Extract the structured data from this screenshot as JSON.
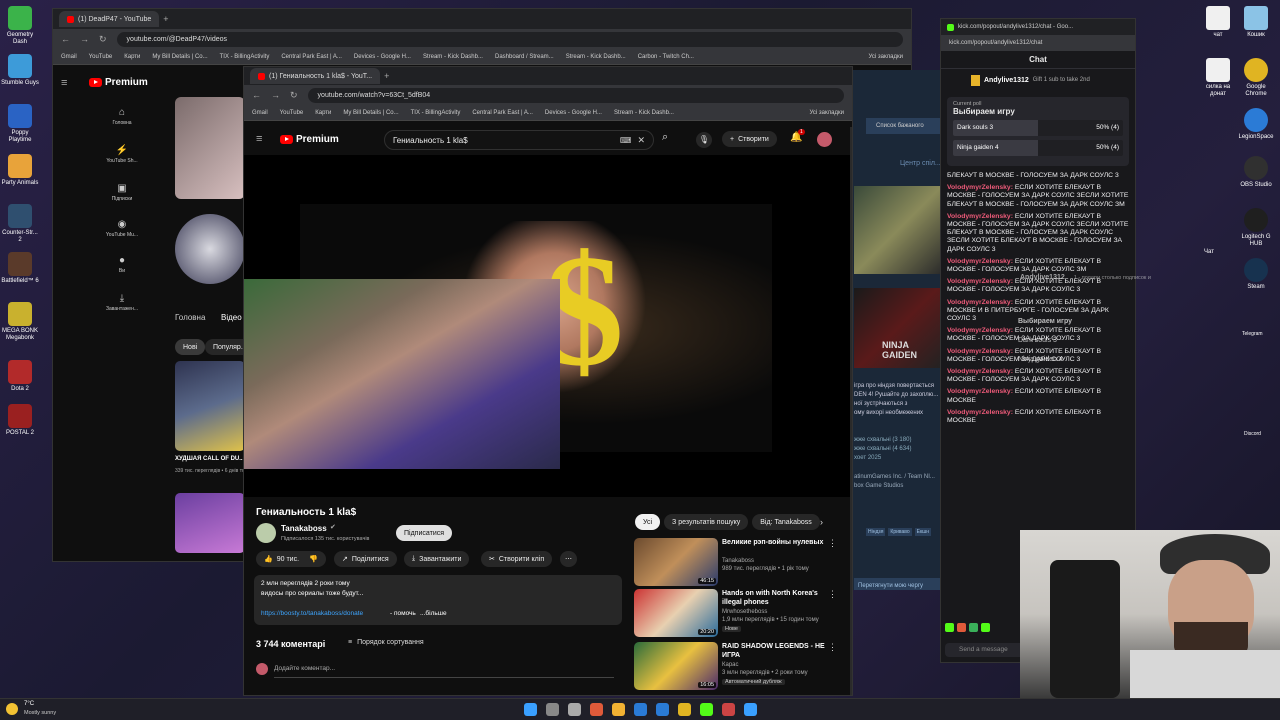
{
  "desktop": {
    "icons_left": [
      {
        "label": "Geometry Dash",
        "color": "#3bb34a"
      },
      {
        "label": "Stumble Guys",
        "color": "#3d9bd9"
      },
      {
        "label": "Poppy Playtime",
        "color": "#2a63c4"
      },
      {
        "label": "Party Animals",
        "color": "#e8a33a"
      },
      {
        "label": "Counter-Str... 2",
        "color": "#2f4f6f"
      },
      {
        "label": "Battlefield™ 6",
        "color": "#5a3a2a"
      },
      {
        "label": "MEGA BONK Megabonk",
        "color": "#c9b12e"
      },
      {
        "label": "Dota 2",
        "color": "#b22a2a"
      },
      {
        "label": "POSTAL 2",
        "color": "#9a2020"
      }
    ],
    "icons_right": [
      {
        "label": "чат",
        "color": "#f0f0f0"
      },
      {
        "label": "Кошик",
        "color": "#8bc3e6"
      },
      {
        "label": "силка на донат",
        "color": "#f0f0f0"
      },
      {
        "label": "Google Chrome",
        "color": "#e0b422"
      },
      {
        "label": "LegionSpace",
        "color": "#2b7bd6"
      },
      {
        "label": "OBS Studio",
        "color": "#303030"
      },
      {
        "label": "Logitech G HUB",
        "color": "#1f1f1f"
      },
      {
        "label": "Steam",
        "color": "#17324f"
      }
    ],
    "right_labels": [
      "Чат",
      "Telegram",
      "Discord"
    ]
  },
  "back_window": {
    "tab_title": "(1) DeadP47 - YouTube",
    "url": "youtube.com/@DeadP47/videos",
    "bookmarks": [
      "Gmail",
      "YouTube",
      "Карти",
      "My Bill Details | Co...",
      "TIX - BillingActivity",
      "Central Park East | A...",
      "Devices - Google H...",
      "Stream - Kick Dashb...",
      "Dashboard / Stream...",
      "Stream - Kick Dashb...",
      "Carbon - Twitch Ch..."
    ],
    "bookmarks_all": "Усі закладки",
    "logo_text": "Premium",
    "sidebar": [
      "Головна",
      "YouTube Sh...",
      "Підписки",
      "YouTube Mu...",
      "Ви",
      "Завантажен..."
    ],
    "channel_tabs": [
      "Головна",
      "Відео"
    ],
    "chips": [
      "Нові",
      "Популяр..."
    ],
    "video_title": "ХУДШАЯ CALL OF DU...",
    "video_meta": "339 тис. переглядів • 6 днів тому"
  },
  "front_window": {
    "tab_title": "(1) Гениальность 1 kla$ - YouT...",
    "url": "youtube.com/watch?v=63Ct_5dfB04",
    "bookmarks": [
      "Gmail",
      "YouTube",
      "Карти",
      "My Bill Details | Co...",
      "TIX - BillingActivity",
      "Central Park East | A...",
      "Devices - Google H...",
      "Stream - Kick Dashb..."
    ],
    "bookmarks_all": "Усі закладки",
    "logo_text": "Premium",
    "search_value": "Гениальность 1 kla$",
    "create_label": "Створити",
    "notif_count": "1",
    "video_title": "Гениальность 1 kla$",
    "channel_name": "Tanakaboss",
    "subs": "Підписалося 135 тис. користувачів",
    "subscribe_label": "Підписатися",
    "likes": "90 тис.",
    "share_label": "Поділитися",
    "download_label": "Завантажити",
    "clip_label": "Створити кліп",
    "desc_line1": "2 млн переглядів  2 роки тому",
    "desc_line2": "видосы про сериалы тоже будут...",
    "desc_link": "https://boosty.to/tanakaboss/donate",
    "desc_suffix": " - помочь",
    "desc_more": "...більше",
    "comments_count": "3 744 коментарі",
    "sort_label": "Порядок сортування",
    "add_comment": "Додайте коментар...",
    "filter_chips": [
      "Усі",
      "З результатів пошуку",
      "Від: Tanakaboss"
    ],
    "recommendations": [
      {
        "title": "Великие рэп-войны нулевых",
        "channel": "Tanakaboss",
        "meta": "989 тис. переглядів • 1 рік тому",
        "duration": "46:15"
      },
      {
        "title": "Hands on with North Korea's illegal phones",
        "channel": "Mrwhosetheboss",
        "meta": "1,9 млн переглядів • 15 годин тому",
        "badge": "Нове",
        "duration": "20:20"
      },
      {
        "title": "RAID SHADOW LEGENDS - НЕ ИГРА",
        "channel": "Карас",
        "meta": "3 млн переглядів • 2 роки тому",
        "badge": "Автоматичний дубляж",
        "duration": "16:05"
      }
    ]
  },
  "middle_fragments": {
    "search_placeholder": "Список бажаного",
    "center_label": "Центр спіл...",
    "game_label": "NINJA GAIDEN",
    "text_lines": [
      "ігра про ніндзя повертається",
      "DEN 4! Рушайте до захоплю...",
      "ної зустрічаються з",
      "ому вихорі необмежених"
    ],
    "reviews": [
      "жже схвальні (3 180)",
      "жже схвальні (4 634)",
      "хоет 2025"
    ],
    "publisher": "atinumGames Inc. / Team NI...",
    "publisher2": "box Game Studios",
    "tags": [
      "Ніндзя",
      "Криваво",
      "Екшн"
    ],
    "button": "Перетягнути мою чергу"
  },
  "chat": {
    "window_title": "kick.com/popout/andylive1312/chat - Goo...",
    "url": "kick.com/popout/andylive1312/chat",
    "header": "Chat",
    "pinned_user": "Andylive1312",
    "pinned_text": "Gift 1 sub to take 2nd",
    "poll_label": "Current poll",
    "poll_question": "Выбираем игру",
    "poll_options": [
      {
        "name": "Dark souls 3",
        "result": "50% (4)",
        "fraction": 0.5
      },
      {
        "name": "Ninja gaiden 4",
        "result": "50% (4)",
        "fraction": 0.5
      }
    ],
    "messages": [
      {
        "user": "",
        "text": "БЛЕКАУТ В МОСКВЕ - ГОЛОСУЕМ ЗА ДАРК СОУЛС 3"
      },
      {
        "user": "VolodymyrZelensky:",
        "text": " ЕСЛИ ХОТИТЕ БЛЕКАУТ В МОСКВЕ - ГОЛОСУЕМ ЗА ДАРК СОУЛС ЗЕСЛИ ХОТИТЕ БЛЕКАУТ В МОСКВЕ - ГОЛОСУЕМ ЗА ДАРК СОУЛС ЗМ"
      },
      {
        "user": "VolodymyrZelensky:",
        "text": " ЕСЛИ ХОТИТЕ БЛЕКАУТ В МОСКВЕ - ГОЛОСУЕМ ЗА ДАРК СОУЛС ЗЕСЛИ ХОТИТЕ БЛЕКАУТ В МОСКВЕ - ГОЛОСУЕМ ЗА ДАРК СОУЛС ЗЕСЛИ ХОТИТЕ БЛЕКАУТ В МОСКВЕ - ГОЛОСУЕМ ЗА ДАРК СОУЛС 3"
      },
      {
        "user": "VolodymyrZelensky:",
        "text": " ЕСЛИ ХОТИТЕ БЛЕКАУТ В МОСКВЕ - ГОЛОСУЕМ ЗА ДАРК СОУЛС ЗМ"
      },
      {
        "user": "VolodymyrZelensky:",
        "text": " ЕСЛИ ХОТИТЕ БЛЕКАУТ В МОСКВЕ - ГОЛОСУЕМ ЗА ДАРК СОУЛС 3"
      },
      {
        "user": "VolodymyrZelensky:",
        "text": " ЕСЛИ ХОТИТЕ БЛЕКАУТ В МОСКВЕ И В ПИТЕРБУРГЕ - ГОЛОСУЕМ ЗА ДАРК СОУЛС 3"
      },
      {
        "user": "VolodymyrZelensky:",
        "text": " ЕСЛИ ХОТИТЕ БЛЕКАУТ В МОСКВЕ - ГОЛОСУЕМ ЗА ДАРК СОУЛС 3"
      },
      {
        "user": "VolodymyrZelensky:",
        "text": " ЕСЛИ ХОТИТЕ БЛЕКАУТ В МОСКВЕ - ГОЛОСУЕМ ЗА ДАРК СОУЛС 3"
      },
      {
        "user": "VolodymyrZelensky:",
        "text": " ЕСЛИ ХОТИТЕ БЛЕКАУТ В МОСКВЕ - ГОЛОСУЕМ ЗА ДАРК СОУЛС 3"
      },
      {
        "user": "VolodymyrZelensky:",
        "text": " ЕСЛИ ХОТИТЕ БЛЕКАУТ В МОСКВЕ"
      },
      {
        "user": "VolodymyrZelensky:",
        "text": " ЕСЛИ ХОТИТЕ БЛЕКАУТ В МОСКВЕ"
      }
    ],
    "send_placeholder": "Send a message"
  },
  "overlay": {
    "user": "Andylive1312",
    "text": "1 - подари столько подписок и",
    "poll_question": "Выбираем игру",
    "options": [
      "Dark souls 3",
      "Ninja gaiden 4"
    ]
  },
  "taskbar": {
    "weather_temp": "7°C",
    "weather_text": "Mostly sunny"
  }
}
